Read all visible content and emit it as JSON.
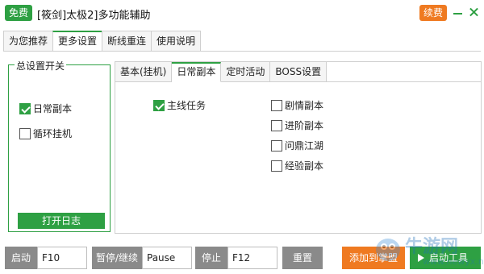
{
  "titlebar": {
    "free_badge": "免费",
    "title": "[筱剑]太极2]多功能辅助",
    "renew_label": "续费"
  },
  "top_tabs": [
    {
      "label": "为您推荐",
      "active": false
    },
    {
      "label": "更多设置",
      "active": true
    },
    {
      "label": "断线重连",
      "active": false
    },
    {
      "label": "使用说明",
      "active": false
    }
  ],
  "left_group": {
    "title": "总设置开关",
    "options": [
      {
        "label": "日常副本",
        "checked": true
      },
      {
        "label": "循环挂机",
        "checked": false
      }
    ],
    "log_button": "打开日志"
  },
  "inner_tabs": [
    {
      "label": "基本(挂机)",
      "active": false
    },
    {
      "label": "日常副本",
      "active": true
    },
    {
      "label": "定时活动",
      "active": false
    },
    {
      "label": "BOSS设置",
      "active": false
    }
  ],
  "daily_tasks": {
    "left": [
      {
        "label": "主线任务",
        "checked": true
      }
    ],
    "right": [
      {
        "label": "剧情副本",
        "checked": false
      },
      {
        "label": "进阶副本",
        "checked": false
      },
      {
        "label": "问鼎江湖",
        "checked": false
      },
      {
        "label": "经验副本",
        "checked": false
      }
    ]
  },
  "hotkeys": {
    "start_label": "启动",
    "start_value": "F10",
    "pause_label": "暂停/继续",
    "pause_value": "Pause",
    "stop_label": "停止",
    "stop_value": "F12",
    "reset_label": "重置"
  },
  "actions": {
    "add_label": "添加到掌盟",
    "start_tool_label": "启动工具"
  },
  "watermark": {
    "text": "牛游网",
    "url": "www.newyx.net"
  },
  "colors": {
    "green": "#2ea043",
    "orange": "#ef7a21",
    "gray": "#8a8a8a"
  }
}
